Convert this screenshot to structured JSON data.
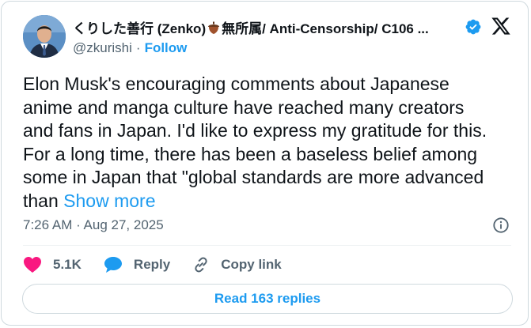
{
  "author": {
    "display_name_prefix": "くりした善行 (Zenko)",
    "display_name_suffix": "無所属/ Anti-Censorship/ C106 ...",
    "handle": "@zkurishi",
    "separator": "·",
    "follow_label": "Follow"
  },
  "tweet": {
    "lines": [
      "Elon Musk's encouraging comments about Japanese",
      "anime and manga culture have reached many creators",
      "and fans in Japan. I'd like to express my gratitude for this.",
      "For a long time, there has been a baseless belief among",
      "some in Japan that \"global standards are more advanced",
      "than"
    ],
    "show_more_label": "Show more",
    "timestamp": "7:26 AM · Aug 27, 2025"
  },
  "actions": {
    "likes": "5.1K",
    "reply_label": "Reply",
    "copy_link_label": "Copy link"
  },
  "read_replies_label": "Read 163 replies",
  "icons": [
    "verified-badge-icon",
    "x-logo-icon",
    "info-icon",
    "heart-icon",
    "reply-bubble-icon",
    "link-icon",
    "acorn-emoji-icon"
  ],
  "colors": {
    "accent": "#1d9bf0",
    "like": "#f91880",
    "text": "#0f1419",
    "muted": "#536471",
    "border": "#cfd9de"
  }
}
